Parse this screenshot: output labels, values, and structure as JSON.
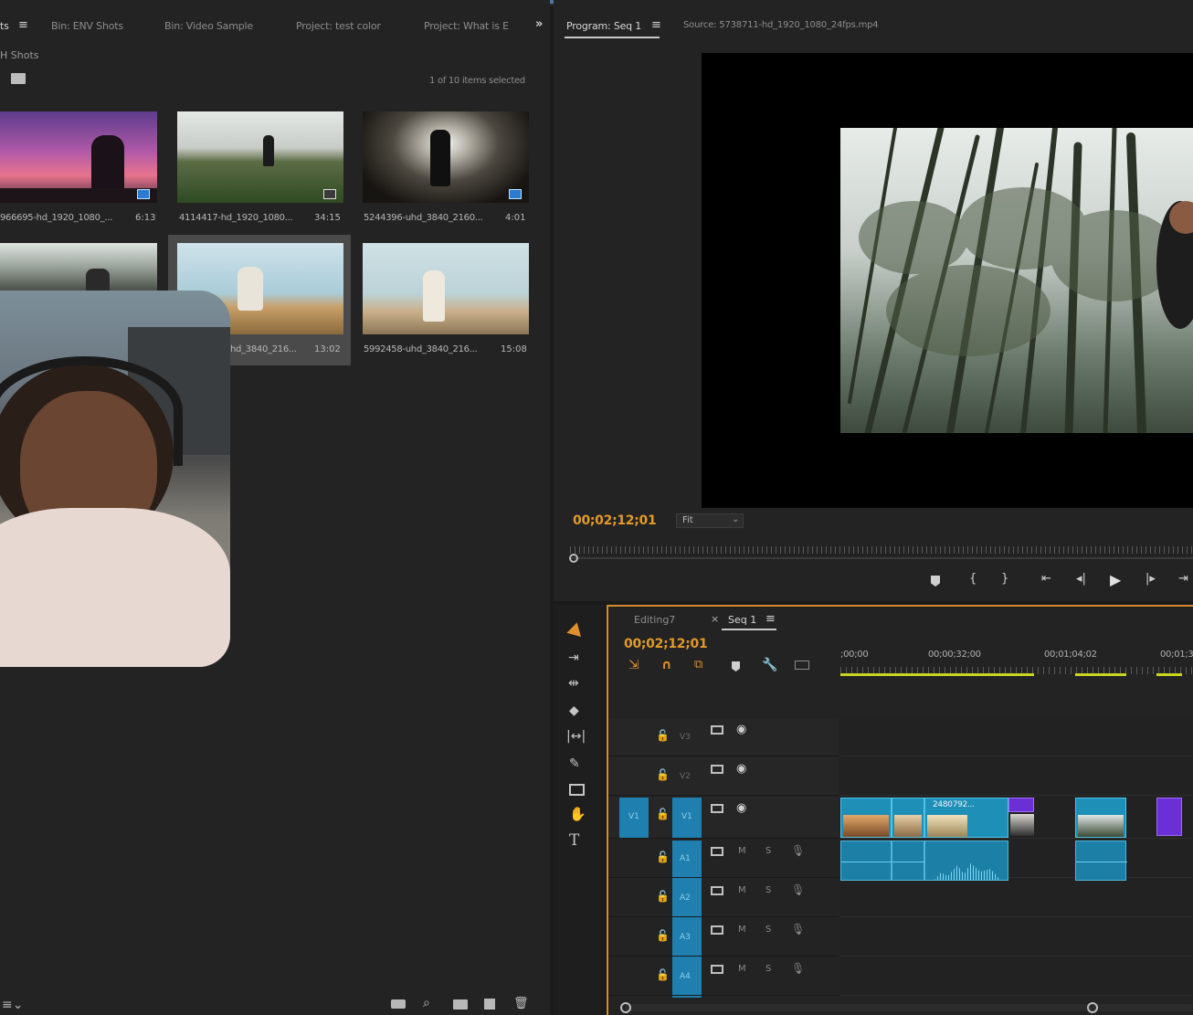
{
  "project_panel": {
    "tabs": [
      {
        "label": "ts"
      },
      {
        "label": "Bin: ENV Shots"
      },
      {
        "label": "Bin: Video Sample"
      },
      {
        "label": "Project: test color"
      },
      {
        "label": "Project: What is E"
      }
    ],
    "breadcrumb": "H Shots",
    "selection_status": "1 of 10 items selected",
    "clips": [
      {
        "name": "966695-hd_1920_1080_...",
        "duration": "6:13",
        "badge": "blue"
      },
      {
        "name": "4114417-hd_1920_1080...",
        "duration": "34:15",
        "badge": "gray"
      },
      {
        "name": "5244396-uhd_3840_2160...",
        "duration": "4:01",
        "badge": "blue"
      },
      {
        "name": "",
        "duration": "",
        "badge": "none"
      },
      {
        "name": "hd_3840_216...",
        "duration": "13:02",
        "badge": "none"
      },
      {
        "name": "5992458-uhd_3840_216...",
        "duration": "15:08",
        "badge": "none"
      }
    ]
  },
  "program_monitor": {
    "tabs": [
      {
        "label": "Program: Seq 1"
      },
      {
        "label": "Source: 5738711-hd_1920_1080_24fps.mp4"
      }
    ],
    "timecode": "00;02;12;01",
    "zoom": "Fit"
  },
  "timeline": {
    "tabs": [
      {
        "label": "Editing7"
      },
      {
        "label": "Seq 1"
      }
    ],
    "timecode": "00;02;12;01",
    "ruler_labels": [
      ";00;00",
      "00;00;32;00",
      "00;01;04;02",
      "00;01;3"
    ],
    "video_tracks": [
      {
        "label": "V3"
      },
      {
        "label": "V2"
      },
      {
        "label": "V1",
        "source_label": "V1"
      }
    ],
    "audio_tracks": [
      {
        "label": "A1"
      },
      {
        "label": "A2"
      },
      {
        "label": "A3"
      },
      {
        "label": "A4"
      }
    ],
    "clip_label": "2480792...",
    "track_toggle_m": "M",
    "track_toggle_s": "S"
  },
  "colors": {
    "accent_orange": "#e09a2a",
    "clip_blue": "#1e8fb6",
    "clip_purple": "#6b2fd6",
    "panel_bg": "#232323"
  }
}
